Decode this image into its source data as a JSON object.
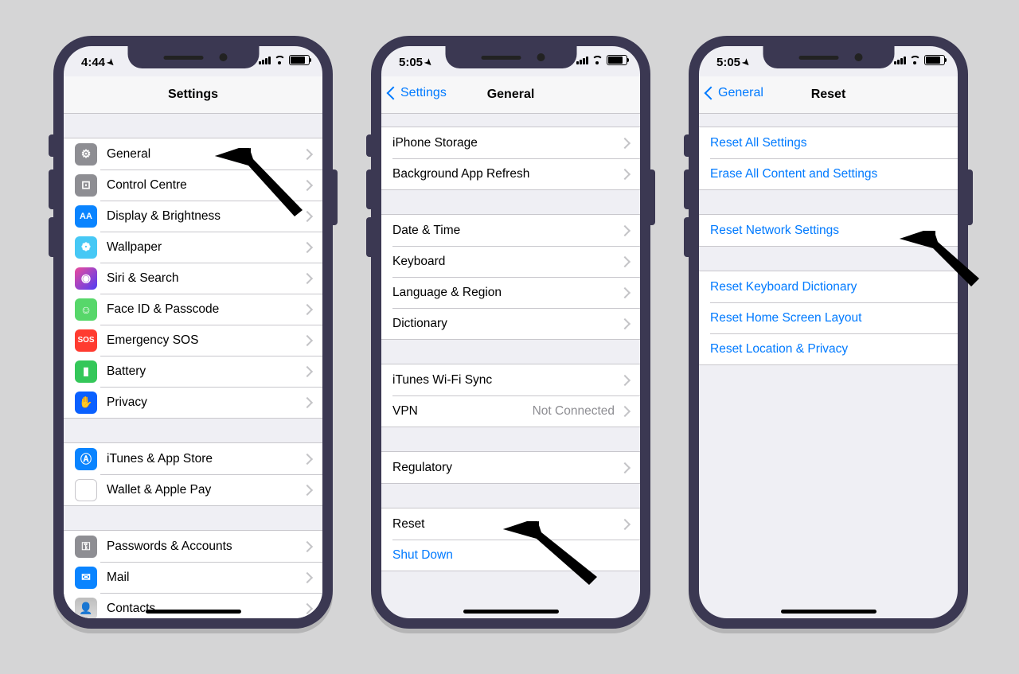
{
  "status": {
    "time1": "4:44",
    "time2": "5:05",
    "time3": "5:05",
    "loc": "➤"
  },
  "phone1": {
    "title": "Settings",
    "rows": [
      {
        "label": "General",
        "icon": "gear"
      },
      {
        "label": "Control Centre",
        "icon": "control"
      },
      {
        "label": "Display & Brightness",
        "icon": "AA"
      },
      {
        "label": "Wallpaper",
        "icon": "flower"
      },
      {
        "label": "Siri & Search",
        "icon": "siri"
      },
      {
        "label": "Face ID & Passcode",
        "icon": "face"
      },
      {
        "label": "Emergency SOS",
        "icon": "SOS"
      },
      {
        "label": "Battery",
        "icon": "batt"
      },
      {
        "label": "Privacy",
        "icon": "hand"
      }
    ],
    "rows2": [
      {
        "label": "iTunes & App Store",
        "icon": "A"
      },
      {
        "label": "Wallet & Apple Pay",
        "icon": "wallet"
      }
    ],
    "rows3": [
      {
        "label": "Passwords & Accounts",
        "icon": "key"
      },
      {
        "label": "Mail",
        "icon": "mail"
      },
      {
        "label": "Contacts",
        "icon": "contacts"
      }
    ]
  },
  "phone2": {
    "back": "Settings",
    "title": "General",
    "g1": [
      {
        "label": "iPhone Storage"
      },
      {
        "label": "Background App Refresh"
      }
    ],
    "g2": [
      {
        "label": "Date & Time"
      },
      {
        "label": "Keyboard"
      },
      {
        "label": "Language & Region"
      },
      {
        "label": "Dictionary"
      }
    ],
    "g3": [
      {
        "label": "iTunes Wi-Fi Sync"
      },
      {
        "label": "VPN",
        "value": "Not Connected"
      }
    ],
    "g4": [
      {
        "label": "Regulatory"
      }
    ],
    "g5": [
      {
        "label": "Reset"
      },
      {
        "label": "Shut Down",
        "link": true,
        "nochev": true
      }
    ]
  },
  "phone3": {
    "back": "General",
    "title": "Reset",
    "g1": [
      {
        "label": "Reset All Settings"
      },
      {
        "label": "Erase All Content and Settings"
      }
    ],
    "g2": [
      {
        "label": "Reset Network Settings"
      }
    ],
    "g3": [
      {
        "label": "Reset Keyboard Dictionary"
      },
      {
        "label": "Reset Home Screen Layout"
      },
      {
        "label": "Reset Location & Privacy"
      }
    ]
  }
}
